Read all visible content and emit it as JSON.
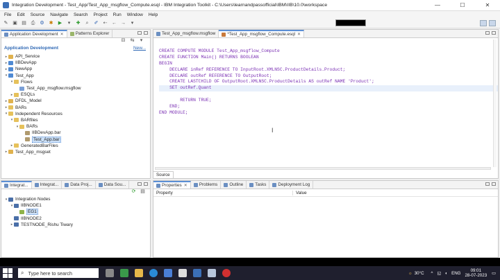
{
  "window": {
    "title": "Integration Development - Test_App/Test_App_msgflow_Compute.esql - IBM Integration Toolkit - C:\\Users\\learnandpassofficial\\IBM\\IIB\\10.0\\workspace",
    "controls": [
      "—",
      "☐",
      "✕"
    ]
  },
  "menu": [
    "File",
    "Edit",
    "Source",
    "Navigate",
    "Search",
    "Project",
    "Run",
    "Window",
    "Help"
  ],
  "left_panel": {
    "tabs": [
      {
        "label": "Application Development",
        "active": true
      },
      {
        "label": "Patterns Explorer",
        "active": false
      }
    ],
    "header": "Application Development",
    "new_link": "New...",
    "tree": [
      {
        "label": "API_Service",
        "depth": 0,
        "icon": "proj",
        "tw": "▸"
      },
      {
        "label": "IIBDevApp",
        "depth": 0,
        "icon": "app",
        "tw": "▸"
      },
      {
        "label": "NewApp",
        "depth": 0,
        "icon": "app",
        "tw": "▸"
      },
      {
        "label": "Test_App",
        "depth": 0,
        "icon": "app",
        "tw": "▾"
      },
      {
        "label": "Flows",
        "depth": 1,
        "icon": "fold",
        "tw": "▾"
      },
      {
        "label": "Test_App_msgflow.msgflow",
        "depth": 2,
        "icon": "flow",
        "tw": ""
      },
      {
        "label": "ESQLs",
        "depth": 1,
        "icon": "fold",
        "tw": "▸"
      },
      {
        "label": "DFDL_Model",
        "depth": 0,
        "icon": "proj",
        "tw": "▸"
      },
      {
        "label": "BARs",
        "depth": 0,
        "icon": "fold",
        "tw": "▸"
      },
      {
        "label": "Independent Resources",
        "depth": 0,
        "icon": "fold",
        "tw": "▾"
      },
      {
        "label": "BARfiles",
        "depth": 1,
        "icon": "fold",
        "tw": "▾"
      },
      {
        "label": "BARs",
        "depth": 2,
        "icon": "fold",
        "tw": "▾"
      },
      {
        "label": "IIBDevApp.bar",
        "depth": 3,
        "icon": "bar",
        "tw": ""
      },
      {
        "label": "Test_App.bar",
        "depth": 3,
        "icon": "bar",
        "tw": "",
        "highlight": true
      },
      {
        "label": "GeneratedBarFiles",
        "depth": 1,
        "icon": "fold",
        "tw": "▸"
      },
      {
        "label": "Test_App_msgset",
        "depth": 0,
        "icon": "proj",
        "tw": "▸"
      }
    ]
  },
  "editor": {
    "tabs": [
      {
        "label": "Test_App_msgflow.msgflow",
        "active": false,
        "dirty": false
      },
      {
        "label": "*Test_App_msgflow_Compute.esql",
        "active": true,
        "dirty": true
      }
    ],
    "code_lines": [
      "",
      "CREATE COMPUTE MODULE Test_App_msgflow_Compute",
      "CREATE FUNCTION Main() RETURNS BOOLEAN",
      "BEGIN",
      "    DECLARE inRef REFERENCE TO InputRoot.XMLNSC.ProductDetails.Product;",
      "    DECLARE outRef REFERENCE TO OutputRoot;",
      "    CREATE LASTCHILD OF OutputRoot.XMLNSC.ProductDetails AS outRef NAME 'Product';",
      "    SET outRef.Quant",
      "",
      "        RETURN TRUE;",
      "    END;",
      "END MODULE;"
    ],
    "bottom_tab": "Source"
  },
  "bottom_left": {
    "tabs": [
      "Integrat...",
      "Integrat...",
      "Data Proj...",
      "Data Sou..."
    ],
    "tree": [
      {
        "label": "Integration Nodes",
        "depth": 0,
        "tw": "▾",
        "icon": "node"
      },
      {
        "label": "IIBNODE1",
        "depth": 1,
        "tw": "▾",
        "icon": "node"
      },
      {
        "label": "EG1",
        "depth": 2,
        "tw": "",
        "icon": "srv",
        "highlight": true
      },
      {
        "label": "IIBNODE2",
        "depth": 1,
        "tw": "",
        "icon": "node"
      },
      {
        "label": "TESTNODE_Rishu Tiwary",
        "depth": 1,
        "tw": "▸",
        "icon": "node"
      }
    ]
  },
  "bottom_right": {
    "tabs": [
      {
        "label": "Properties",
        "active": true
      },
      {
        "label": "Problems",
        "active": false
      },
      {
        "label": "Outline",
        "active": false
      },
      {
        "label": "Tasks",
        "active": false
      },
      {
        "label": "Deployment Log",
        "active": false
      }
    ],
    "columns": [
      "Property",
      "Value"
    ]
  },
  "taskbar": {
    "search_placeholder": "Type here to search",
    "weather": "30°C",
    "lang": "ENG",
    "time": "09:01",
    "date": "28-07-2023"
  }
}
